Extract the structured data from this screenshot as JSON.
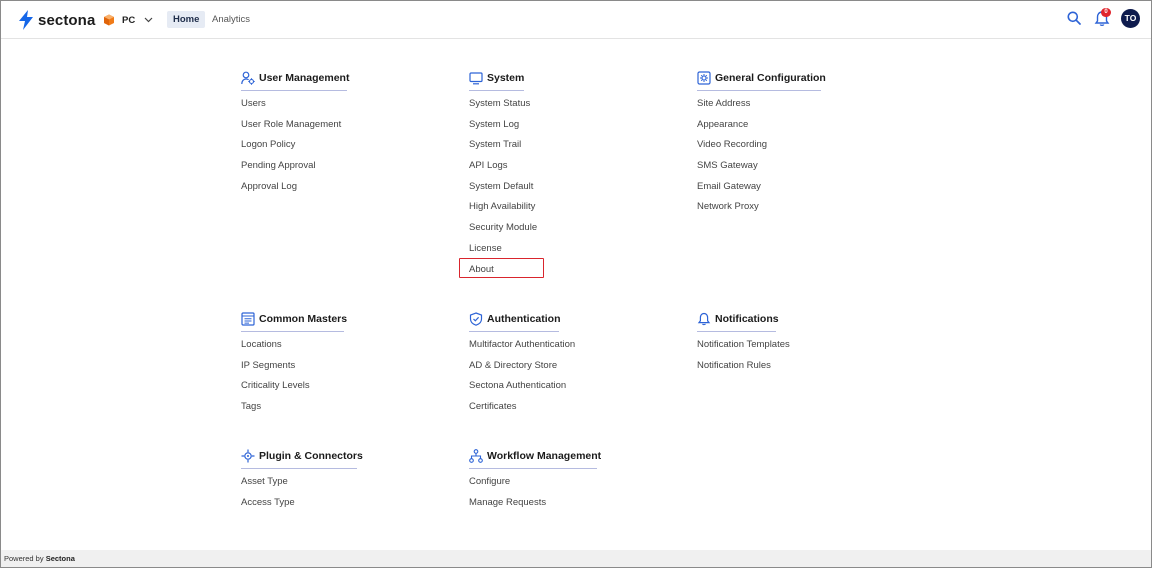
{
  "header": {
    "brand": "sectona",
    "env_label": "PC",
    "nav": {
      "home": "Home",
      "analytics": "Analytics"
    },
    "notification_count": "0",
    "avatar_initials": "TO",
    "icons": {
      "brand": "bolt-logo-icon",
      "env": "cube-icon",
      "search": "search-icon",
      "bell": "bell-icon"
    },
    "colors": {
      "accent": "#2d63d6",
      "brand_bolt": "#1566e8",
      "env_orange": "#f07b18",
      "badge_red": "#e0252d",
      "avatar_bg": "#0e1b4d"
    }
  },
  "sections": {
    "user_management": {
      "title": "User Management",
      "icon": "user-settings-icon",
      "items": [
        "Users",
        "User Role Management",
        "Logon Policy",
        "Pending Approval",
        "Approval Log"
      ]
    },
    "system": {
      "title": "System",
      "icon": "monitor-icon",
      "items": [
        "System Status",
        "System Log",
        "System Trail",
        "API Logs",
        "System Default",
        "High Availability",
        "Security Module",
        "License",
        "About"
      ]
    },
    "general_configuration": {
      "title": "General Configuration",
      "icon": "settings-icon",
      "items": [
        "Site Address",
        "Appearance",
        "Video Recording",
        "SMS Gateway",
        "Email Gateway",
        "Network Proxy"
      ]
    },
    "common_masters": {
      "title": "Common Masters",
      "icon": "list-document-icon",
      "items": [
        "Locations",
        "IP Segments",
        "Criticality Levels",
        "Tags"
      ]
    },
    "authentication": {
      "title": "Authentication",
      "icon": "shield-check-icon",
      "items": [
        "Multifactor Authentication",
        "AD & Directory Store",
        "Sectona Authentication",
        "Certificates"
      ]
    },
    "notifications": {
      "title": "Notifications",
      "icon": "bell-icon",
      "items": [
        "Notification Templates",
        "Notification Rules"
      ]
    },
    "plugin_connectors": {
      "title": "Plugin & Connectors",
      "icon": "plugin-icon",
      "items": [
        "Asset Type",
        "Access Type"
      ]
    },
    "workflow_management": {
      "title": "Workflow Management",
      "icon": "workflow-icon",
      "items": [
        "Configure",
        "Manage Requests"
      ]
    }
  },
  "highlighted_item": "About",
  "footer": {
    "prefix": "Powered by",
    "brand": "Sectona"
  }
}
